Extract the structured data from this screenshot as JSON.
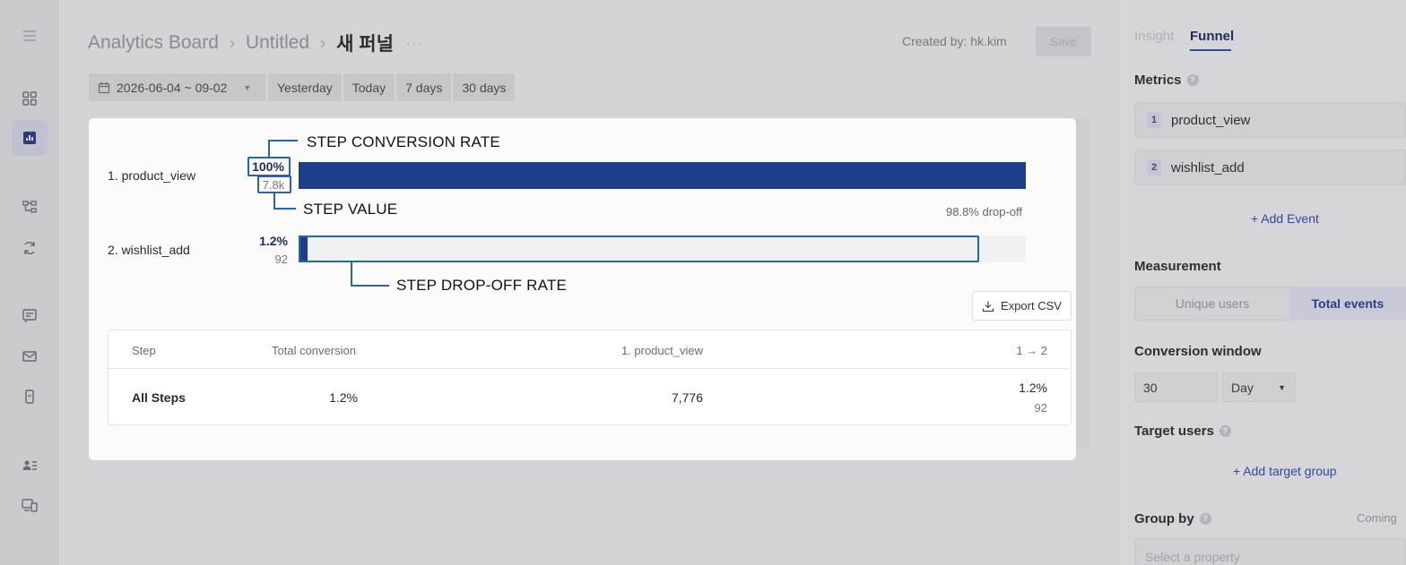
{
  "header": {
    "breadcrumb_root": "Analytics Board",
    "breadcrumb_mid": "Untitled",
    "breadcrumb_current": "새 퍼널",
    "more": "···",
    "created_label": "Created by:",
    "created_by": "hk.kim",
    "save_label": "Save"
  },
  "date_filter": {
    "range": "2026-06-04 ~ 09-02",
    "presets": [
      "Yesterday",
      "Today",
      "7 days",
      "30 days"
    ]
  },
  "funnel": {
    "steps": [
      {
        "label": "1. product_view",
        "rate": "100%",
        "value": "7.8k",
        "fraction": 1.0
      },
      {
        "label": "2. wishlist_add",
        "rate": "1.2%",
        "value": "92",
        "fraction": 0.012
      }
    ],
    "dropoff_text": "98.8% drop-off"
  },
  "annotations": {
    "step_conversion_rate": "STEP CONVERSION RATE",
    "step_value": "STEP VALUE",
    "step_dropoff_rate": "STEP DROP-OFF RATE"
  },
  "export_label": "Export CSV",
  "table": {
    "headers": [
      "Step",
      "Total conversion",
      "1. product_view",
      "1 → 2"
    ],
    "row": {
      "step": "All Steps",
      "total_conversion": "1.2%",
      "product_view": "7,776",
      "step12_rate": "1.2%",
      "step12_value": "92"
    }
  },
  "panel": {
    "tabs": [
      "Insight",
      "Funnel"
    ],
    "active_tab": "Funnel",
    "metrics_title": "Metrics",
    "metrics": [
      {
        "num": "1",
        "name": "product_view"
      },
      {
        "num": "2",
        "name": "wishlist_add"
      }
    ],
    "add_event": "+ Add Event",
    "measurement_title": "Measurement",
    "measurement_options": [
      "Unique users",
      "Total events"
    ],
    "measurement_selected": "Total events",
    "conversion_window_title": "Conversion window",
    "conversion_window_value": "30",
    "conversion_window_unit": "Day",
    "target_users_title": "Target users",
    "add_target_group": "+ Add target group",
    "group_by_title": "Group by",
    "coming_soon": "Coming",
    "select_property_placeholder": "Select a property"
  },
  "colors": {
    "bar": "#1c3d8a",
    "callout": "#2563b8",
    "accent_text": "#1f2d5a"
  }
}
